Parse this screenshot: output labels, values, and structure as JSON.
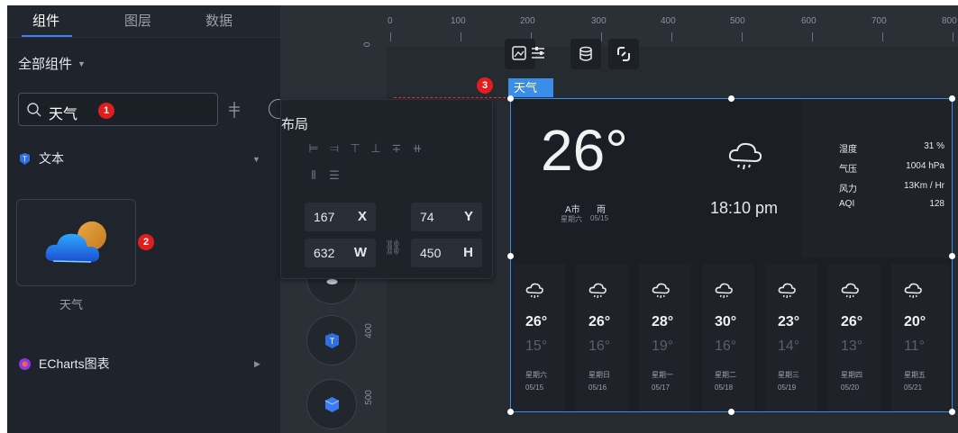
{
  "left_panel": {
    "tabs": [
      {
        "label": "组件",
        "active": true
      },
      {
        "label": "图层",
        "active": false
      },
      {
        "label": "数据",
        "active": false
      }
    ],
    "all_components_label": "全部组件",
    "search": {
      "value": "天气"
    },
    "categories": [
      {
        "label": "文本"
      },
      {
        "label": "ECharts图表"
      }
    ],
    "component_card": {
      "label": "天气"
    }
  },
  "steps": [
    "1",
    "2",
    "3"
  ],
  "ruler": {
    "top_ticks": [
      "0",
      "100",
      "200",
      "300",
      "400",
      "500",
      "600",
      "700",
      "800"
    ],
    "left_ticks": [
      "0",
      "400",
      "500"
    ]
  },
  "layout_panel": {
    "title": "布局",
    "x": {
      "value": "167",
      "key": "X"
    },
    "y": {
      "value": "74",
      "key": "Y"
    },
    "w": {
      "value": "632",
      "key": "W"
    },
    "h": {
      "value": "450",
      "key": "H"
    }
  },
  "selection_label": "天气",
  "weather": {
    "current_temp": "26°",
    "city": "A市",
    "weekday": "星期六",
    "condition": "雨",
    "date": "05/15",
    "time": "18:10 pm",
    "stats": [
      {
        "key": "湿度",
        "value": "31 %"
      },
      {
        "key": "气压",
        "value": "1004 hPa"
      },
      {
        "key": "风力",
        "value": "13Km / Hr"
      },
      {
        "key": "AQI",
        "value": "128"
      }
    ],
    "forecast": [
      {
        "high": "26°",
        "low": "15°",
        "weekday": "星期六",
        "date": "05/15"
      },
      {
        "high": "26°",
        "low": "16°",
        "weekday": "星期日",
        "date": "05/16"
      },
      {
        "high": "28°",
        "low": "19°",
        "weekday": "星期一",
        "date": "05/17"
      },
      {
        "high": "30°",
        "low": "16°",
        "weekday": "星期二",
        "date": "05/18"
      },
      {
        "high": "23°",
        "low": "14°",
        "weekday": "星期三",
        "date": "05/19"
      },
      {
        "high": "26°",
        "low": "13°",
        "weekday": "星期四",
        "date": "05/20"
      },
      {
        "high": "20°",
        "low": "11°",
        "weekday": "星期五",
        "date": "05/21"
      }
    ]
  },
  "colors": {
    "accent": "#3a8de8",
    "badge": "#e01e1e",
    "panel_bg": "#1f232b"
  }
}
